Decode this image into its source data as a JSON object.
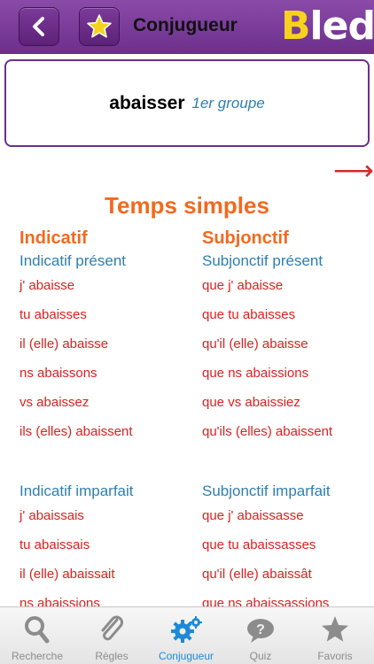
{
  "header": {
    "title": "Conjugueur",
    "logo_le": "le",
    "logo_b": "B",
    "logo_rest": "led"
  },
  "verb": {
    "infinitive": "abaisser",
    "group": "1er groupe"
  },
  "section_title": "Temps simples",
  "indicatif": {
    "mood": "Indicatif",
    "present": {
      "label": "Indicatif présent",
      "forms": [
        "j'  abaisse",
        "tu  abaisses",
        "il (elle)  abaisse",
        "ns  abaissons",
        "vs  abaissez",
        "ils (elles)  abaissent"
      ]
    },
    "imparfait": {
      "label": "Indicatif imparfait",
      "forms": [
        "j'  abaissais",
        "tu  abaissais",
        "il (elle)  abaissait",
        "ns  abaissions"
      ]
    }
  },
  "subjonctif": {
    "mood": "Subjonctif",
    "present": {
      "label": "Subjonctif présent",
      "forms": [
        "que j'  abaisse",
        "que tu  abaisses",
        "qu'il (elle)  abaisse",
        "que ns  abaissions",
        "que vs  abaissiez",
        "qu'ils (elles)  abaissent"
      ]
    },
    "imparfait": {
      "label": "Subjonctif imparfait",
      "forms": [
        "que j'  abaissasse",
        "que tu  abaissasses",
        "qu'il (elle)  abaissât",
        "que ns  abaissassions"
      ]
    }
  },
  "tabs": [
    {
      "label": "Recherche",
      "icon": "search-icon"
    },
    {
      "label": "Règles",
      "icon": "paperclip-icon"
    },
    {
      "label": "Conjugueur",
      "icon": "gears-icon"
    },
    {
      "label": "Quiz",
      "icon": "question-cloud-icon"
    },
    {
      "label": "Favoris",
      "icon": "star-icon"
    }
  ],
  "active_tab": "Conjugueur",
  "colors": {
    "header_purple": "#7a3a9a",
    "orange": "#f26a1f",
    "blue": "#2d7fb3",
    "red": "#e02020",
    "active_tab": "#1c8ad6"
  }
}
